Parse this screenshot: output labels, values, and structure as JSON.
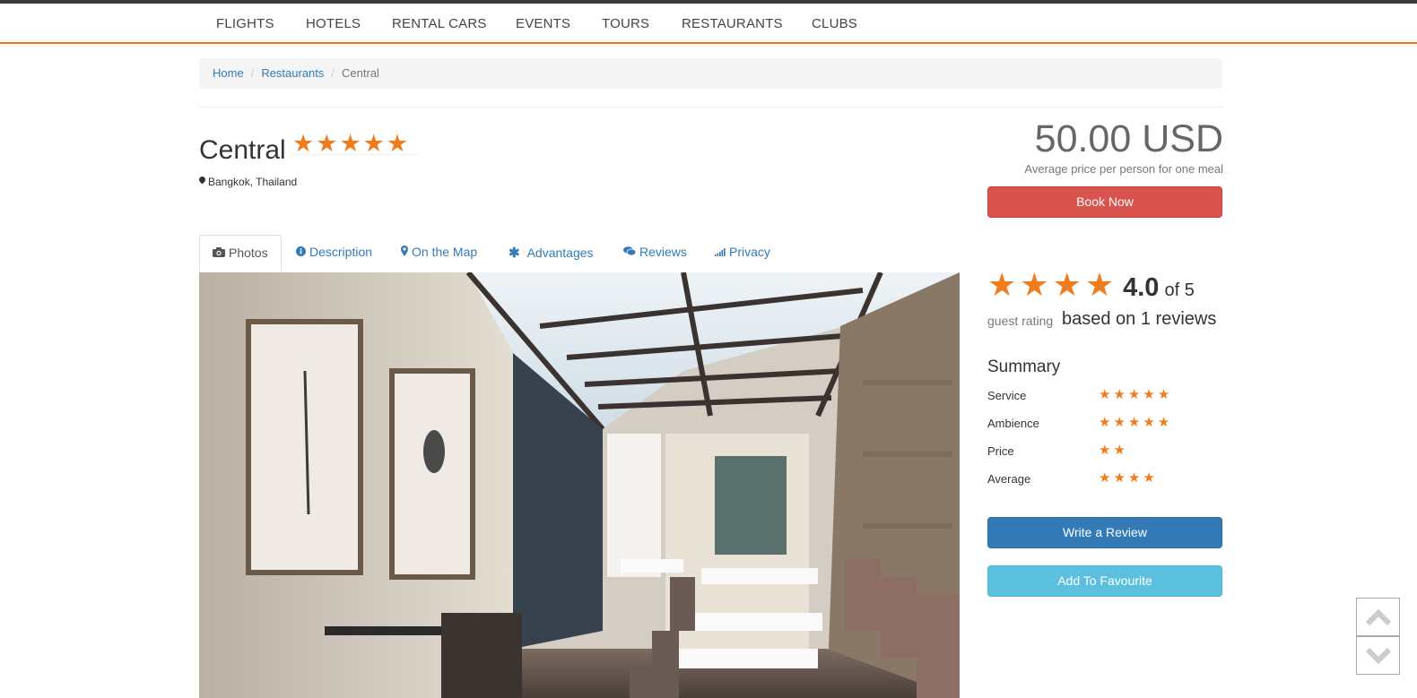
{
  "nav": {
    "items": [
      {
        "label": "FLIGHTS"
      },
      {
        "label": "HOTELS"
      },
      {
        "label": "RENTAL CARS"
      },
      {
        "label": "EVENTS"
      },
      {
        "label": "TOURS"
      },
      {
        "label": "RESTAURANTS"
      },
      {
        "label": "CLUBS"
      }
    ]
  },
  "breadcrumb": {
    "home": "Home",
    "section": "Restaurants",
    "current": "Central"
  },
  "restaurant": {
    "name": "Central",
    "stars": 5,
    "location": "Bangkok, Thailand",
    "price": "50.00 USD",
    "price_note": "Average price per person for one meal"
  },
  "buttons": {
    "book": "Book Now",
    "review": "Write a Review",
    "favourite": "Add To Favourite"
  },
  "tabs": [
    {
      "label": "Photos",
      "icon": "camera-icon"
    },
    {
      "label": "Description",
      "icon": "info-icon"
    },
    {
      "label": "On the Map",
      "icon": "map-marker-icon"
    },
    {
      "label": "Advantages",
      "icon": "asterisk-icon"
    },
    {
      "label": "Reviews",
      "icon": "comments-icon"
    },
    {
      "label": "Privacy",
      "icon": "signal-icon"
    }
  ],
  "rating": {
    "stars": 4,
    "score": "4.0",
    "of": "of 5",
    "guest_label": "guest rating",
    "based_on": "based on 1 reviews"
  },
  "summary": {
    "title": "Summary",
    "items": [
      {
        "label": "Service",
        "stars": 5
      },
      {
        "label": "Ambience",
        "stars": 5
      },
      {
        "label": "Price",
        "stars": 2
      },
      {
        "label": "Average",
        "stars": 4
      }
    ]
  },
  "colors": {
    "accent": "#f07c1e",
    "book": "#d9534f",
    "review": "#337ab7",
    "favourite": "#5bc0de"
  }
}
